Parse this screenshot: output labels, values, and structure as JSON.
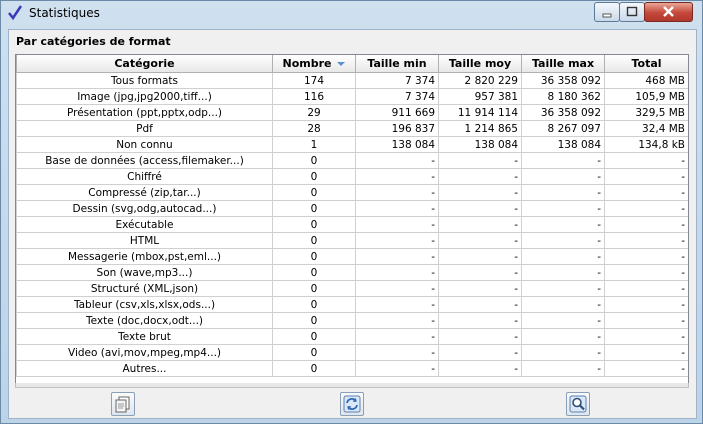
{
  "window": {
    "title": "Statistiques"
  },
  "section": {
    "title": "Par catégories de format"
  },
  "columns": [
    "Catégorie",
    "Nombre",
    "Taille min",
    "Taille moy",
    "Taille max",
    "Total"
  ],
  "rows": [
    [
      "Tous formats",
      "174",
      "7 374",
      "2 820 229",
      "36 358 092",
      "468 MB"
    ],
    [
      "Image (jpg,jpg2000,tiff...)",
      "116",
      "7 374",
      "957 381",
      "8 180 362",
      "105,9 MB"
    ],
    [
      "Présentation (ppt,pptx,odp...)",
      "29",
      "911 669",
      "11 914 114",
      "36 358 092",
      "329,5 MB"
    ],
    [
      "Pdf",
      "28",
      "196 837",
      "1 214 865",
      "8 267 097",
      "32,4 MB"
    ],
    [
      "Non connu",
      "1",
      "138 084",
      "138 084",
      "138 084",
      "134,8 kB"
    ],
    [
      "Base de données (access,filemaker...)",
      "0",
      "-",
      "-",
      "-",
      "-"
    ],
    [
      "Chiffré",
      "0",
      "-",
      "-",
      "-",
      "-"
    ],
    [
      "Compressé (zip,tar...)",
      "0",
      "-",
      "-",
      "-",
      "-"
    ],
    [
      "Dessin (svg,odg,autocad...)",
      "0",
      "-",
      "-",
      "-",
      "-"
    ],
    [
      "Exécutable",
      "0",
      "-",
      "-",
      "-",
      "-"
    ],
    [
      "HTML",
      "0",
      "-",
      "-",
      "-",
      "-"
    ],
    [
      "Messagerie (mbox,pst,eml...)",
      "0",
      "-",
      "-",
      "-",
      "-"
    ],
    [
      "Son (wave,mp3...)",
      "0",
      "-",
      "-",
      "-",
      "-"
    ],
    [
      "Structuré (XML,json)",
      "0",
      "-",
      "-",
      "-",
      "-"
    ],
    [
      "Tableur (csv,xls,xlsx,ods...)",
      "0",
      "-",
      "-",
      "-",
      "-"
    ],
    [
      "Texte (doc,docx,odt...)",
      "0",
      "-",
      "-",
      "-",
      "-"
    ],
    [
      "Texte brut",
      "0",
      "-",
      "-",
      "-",
      "-"
    ],
    [
      "Video (avi,mov,mpeg,mp4...)",
      "0",
      "-",
      "-",
      "-",
      "-"
    ],
    [
      "Autres...",
      "0",
      "-",
      "-",
      "-",
      "-"
    ]
  ],
  "icons": {
    "app": "check-icon",
    "toolbar": [
      "copy-icon",
      "refresh-icon",
      "search-icon"
    ]
  },
  "colors": {
    "sort_arrow": "#5a8fd0",
    "close_button": "#c4473b",
    "check": "#3a3ab8"
  }
}
